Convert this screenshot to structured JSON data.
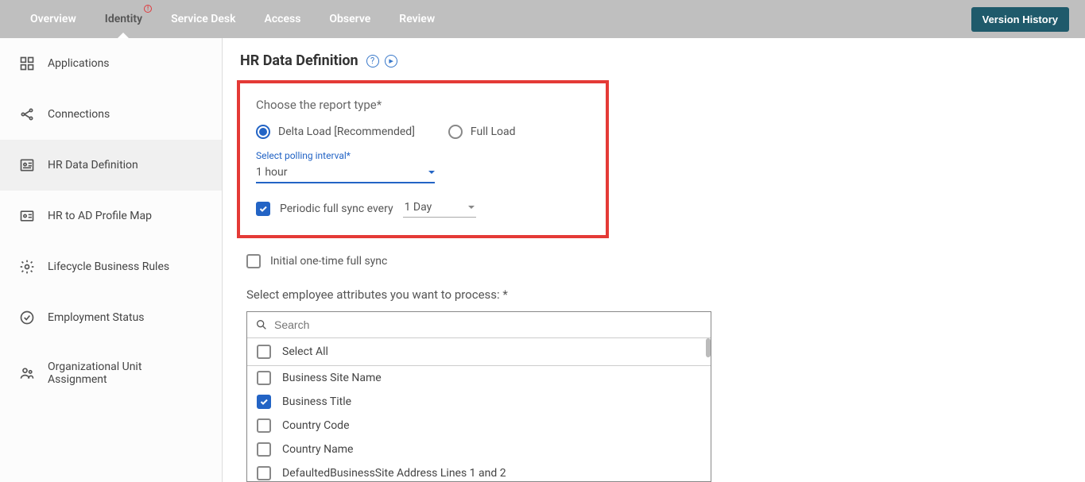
{
  "topnav": {
    "tabs": [
      {
        "label": "Overview"
      },
      {
        "label": "Identity",
        "active": true,
        "alert": true
      },
      {
        "label": "Service Desk"
      },
      {
        "label": "Access"
      },
      {
        "label": "Observe"
      },
      {
        "label": "Review"
      }
    ],
    "version_history": "Version History"
  },
  "sidebar": {
    "items": [
      {
        "label": "Applications",
        "icon": "apps"
      },
      {
        "label": "Connections",
        "icon": "conn"
      },
      {
        "label": "HR Data Definition",
        "icon": "hrdef",
        "active": true
      },
      {
        "label": "HR to AD Profile Map",
        "icon": "idcard"
      },
      {
        "label": "Lifecycle Business Rules",
        "icon": "gear"
      },
      {
        "label": "Employment Status",
        "icon": "check"
      },
      {
        "label": "Organizational Unit Assignment",
        "icon": "people"
      }
    ]
  },
  "page": {
    "title": "HR Data Definition",
    "report_type_label": "Choose the report type*",
    "radio_delta": "Delta Load [Recommended]",
    "radio_full": "Full Load",
    "polling_label": "Select polling interval*",
    "polling_value": "1 hour",
    "periodic_label": "Periodic full sync every",
    "periodic_value": "1 Day",
    "initial_label": "Initial one-time full sync",
    "attr_label": "Select employee attributes you want to process: *",
    "search_placeholder": "Search",
    "attributes": [
      {
        "label": "Select All",
        "checked": false
      },
      {
        "label": "Business Site Name",
        "checked": false
      },
      {
        "label": "Business Title",
        "checked": true
      },
      {
        "label": "Country Code",
        "checked": false
      },
      {
        "label": "Country Name",
        "checked": false
      },
      {
        "label": "DefaultedBusinessSite Address Lines 1 and 2",
        "checked": false
      }
    ]
  }
}
